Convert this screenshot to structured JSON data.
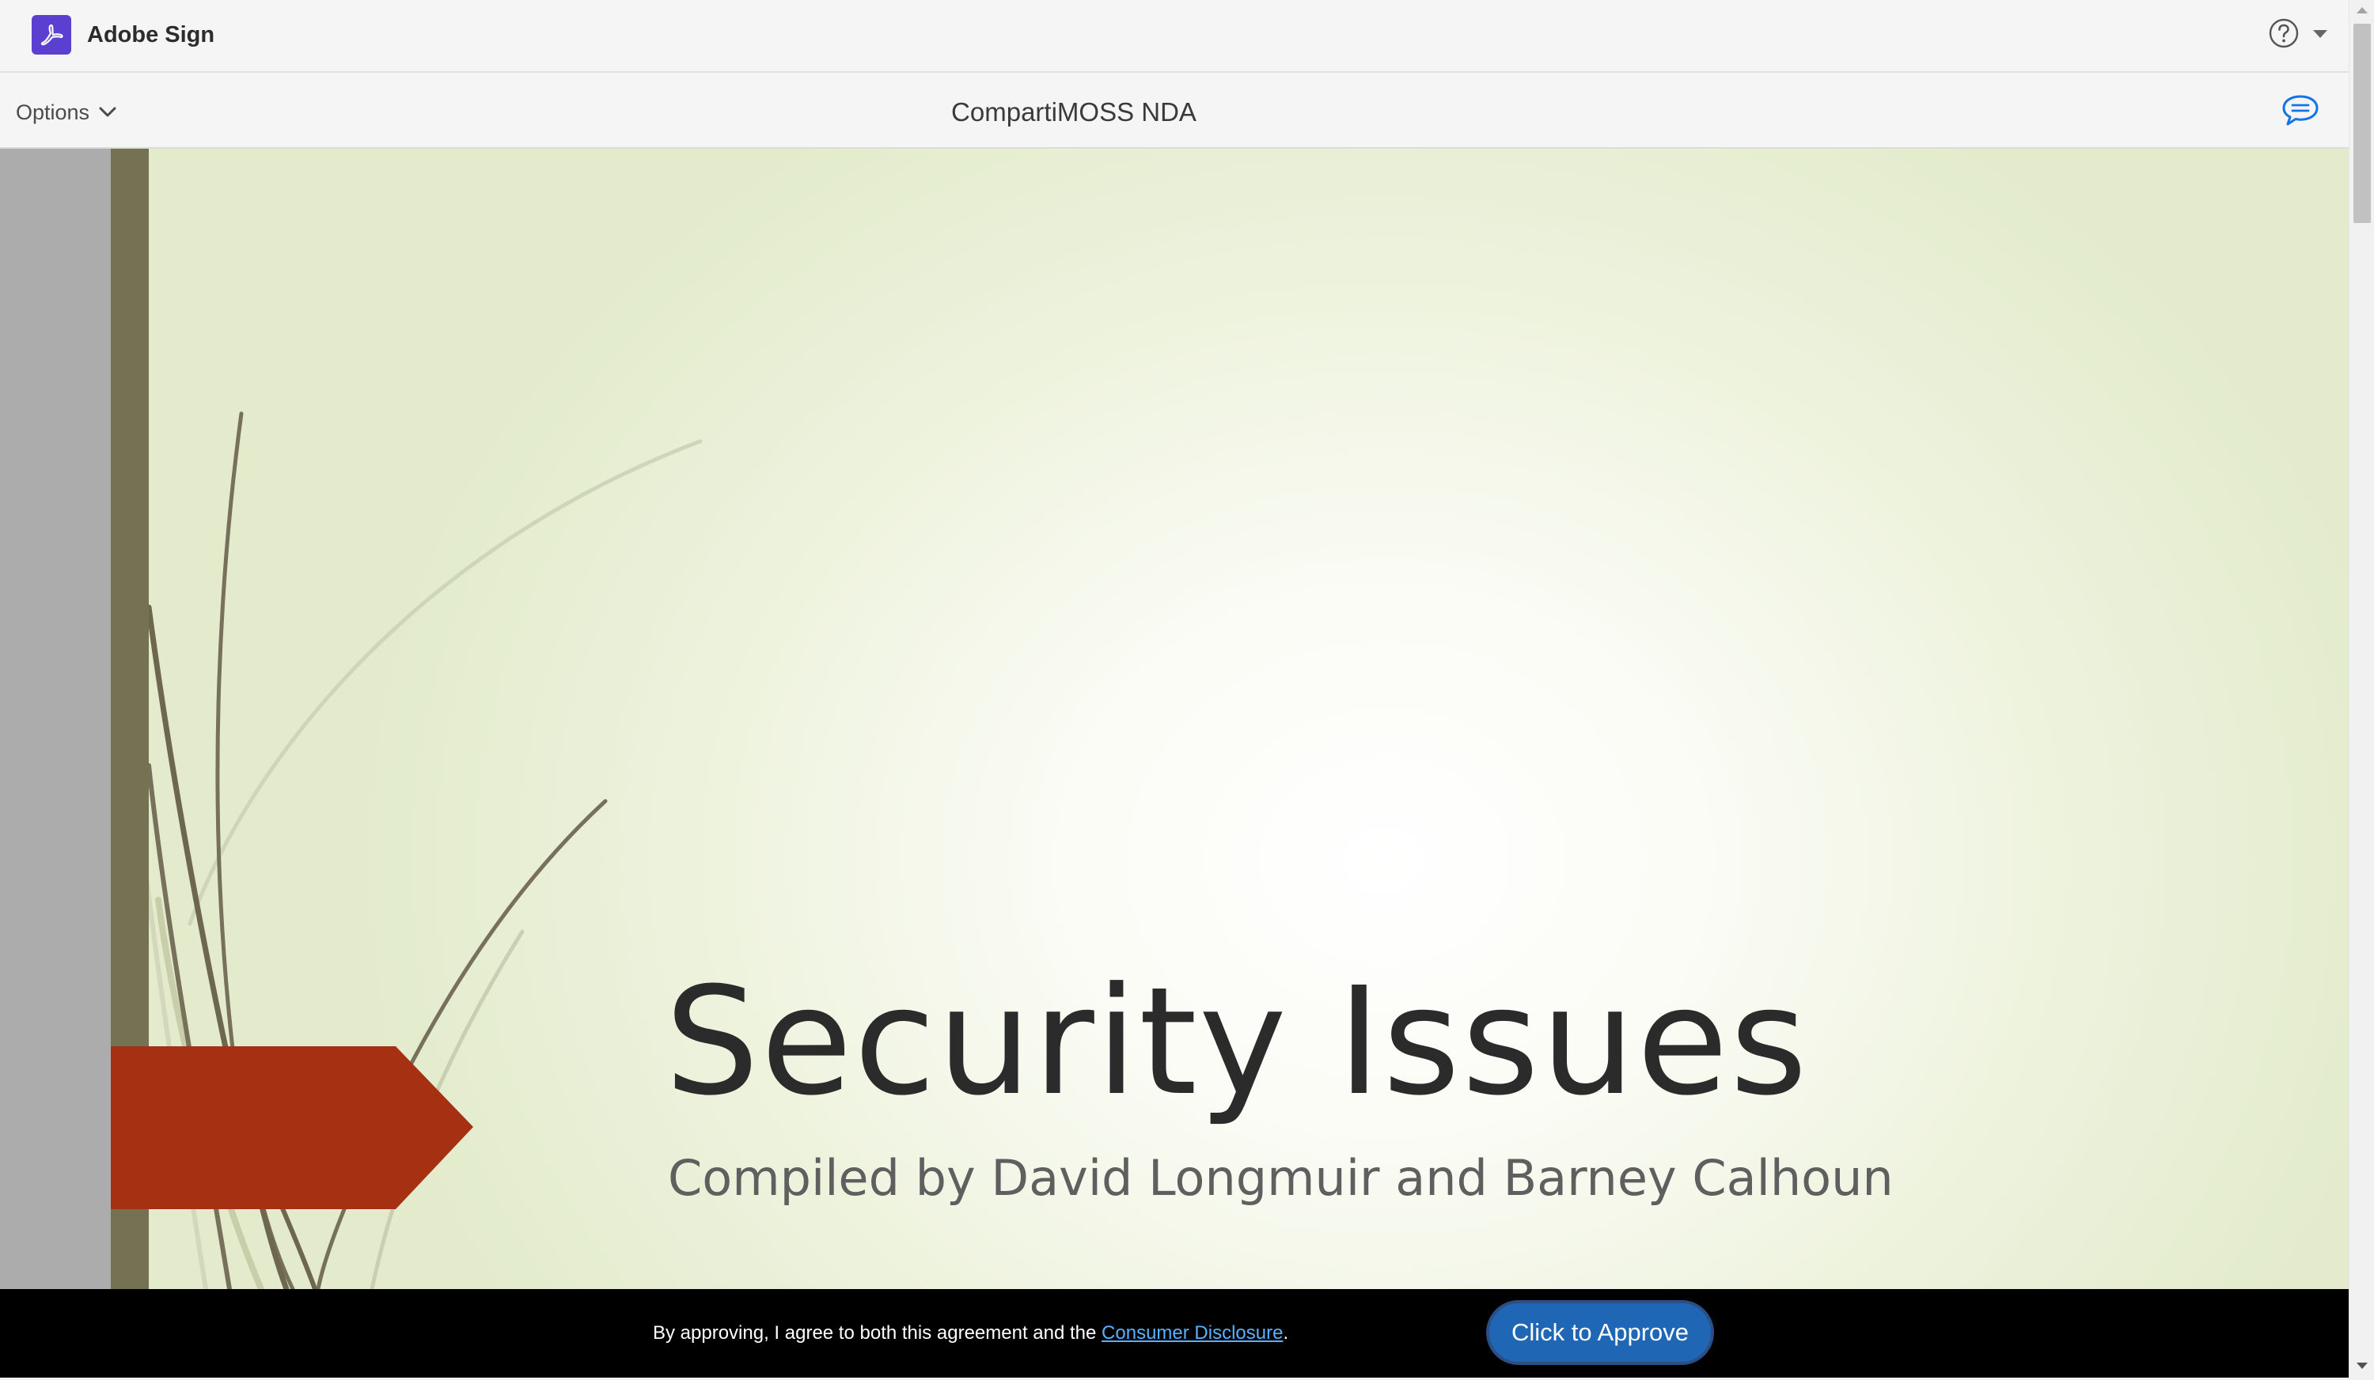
{
  "app": {
    "name": "Adobe Sign",
    "logo_icon": "adobe-acrobat-icon",
    "brand_color": "#5a3fd1"
  },
  "header": {
    "help_icon": "question-circle-icon",
    "help_menu_icon": "caret-down-icon"
  },
  "toolbar": {
    "options_label": "Options",
    "options_icon": "chevron-down-icon",
    "document_title": "CompartiMOSS NDA",
    "comments_icon": "speech-bubble-icon",
    "comments_color": "#1473e6"
  },
  "slide": {
    "title": "Security Issues",
    "subtitle": "Compiled by David Longmuir and Barney Calhoun",
    "accent_color": "#a63012",
    "bar_color": "#757254"
  },
  "approval": {
    "consent_prefix": "By approving, I agree to both this agreement and the ",
    "consent_link": "Consumer Disclosure",
    "consent_suffix": ".",
    "approve_label": "Click to Approve",
    "button_color": "#1f66b4"
  }
}
